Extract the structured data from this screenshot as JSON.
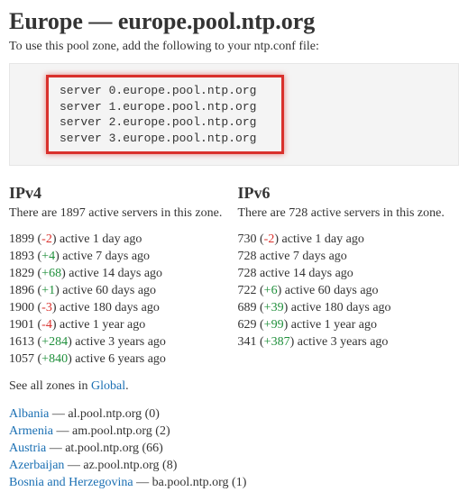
{
  "title": "Europe — europe.pool.ntp.org",
  "intro": "To use this pool zone, add the following to your ntp.conf file:",
  "config_lines": [
    "server 0.europe.pool.ntp.org",
    "server 1.europe.pool.ntp.org",
    "server 2.europe.pool.ntp.org",
    "server 3.europe.pool.ntp.org"
  ],
  "ipv4": {
    "heading": "IPv4",
    "summary_prefix": "There are ",
    "count": "1897",
    "summary_suffix": " active servers in this zone.",
    "history": [
      {
        "count": "1899",
        "delta": "-2",
        "delta_sign": "neg",
        "suffix": " active 1 day ago"
      },
      {
        "count": "1893",
        "delta": "+4",
        "delta_sign": "pos",
        "suffix": " active 7 days ago"
      },
      {
        "count": "1829",
        "delta": "+68",
        "delta_sign": "pos",
        "suffix": " active 14 days ago"
      },
      {
        "count": "1896",
        "delta": "+1",
        "delta_sign": "pos",
        "suffix": " active 60 days ago"
      },
      {
        "count": "1900",
        "delta": "-3",
        "delta_sign": "neg",
        "suffix": " active 180 days ago"
      },
      {
        "count": "1901",
        "delta": "-4",
        "delta_sign": "neg",
        "suffix": " active 1 year ago"
      },
      {
        "count": "1613",
        "delta": "+284",
        "delta_sign": "pos",
        "suffix": " active 3 years ago"
      },
      {
        "count": "1057",
        "delta": "+840",
        "delta_sign": "pos",
        "suffix": " active 6 years ago"
      }
    ]
  },
  "ipv6": {
    "heading": "IPv6",
    "summary_prefix": "There are ",
    "count": "728",
    "summary_suffix": " active servers in this zone.",
    "history": [
      {
        "count": "730",
        "delta": "-2",
        "delta_sign": "neg",
        "suffix": " active 1 day ago"
      },
      {
        "count": "728",
        "delta": "",
        "delta_sign": "",
        "suffix": " active 7 days ago"
      },
      {
        "count": "728",
        "delta": "",
        "delta_sign": "",
        "suffix": " active 14 days ago"
      },
      {
        "count": "722",
        "delta": "+6",
        "delta_sign": "pos",
        "suffix": " active 60 days ago"
      },
      {
        "count": "689",
        "delta": "+39",
        "delta_sign": "pos",
        "suffix": " active 180 days ago"
      },
      {
        "count": "629",
        "delta": "+99",
        "delta_sign": "pos",
        "suffix": " active 1 year ago"
      },
      {
        "count": "341",
        "delta": "+387",
        "delta_sign": "pos",
        "suffix": " active 3 years ago"
      }
    ]
  },
  "see_all": {
    "prefix": "See all zones in ",
    "link": "Global",
    "suffix": "."
  },
  "zones": [
    {
      "name": "Albania",
      "rest": " — al.pool.ntp.org (0)"
    },
    {
      "name": "Armenia",
      "rest": " — am.pool.ntp.org (2)"
    },
    {
      "name": "Austria",
      "rest": " — at.pool.ntp.org (66)"
    },
    {
      "name": "Azerbaijan",
      "rest": " — az.pool.ntp.org (8)"
    },
    {
      "name": "Bosnia and Herzegovina",
      "rest": " — ba.pool.ntp.org (1)"
    }
  ]
}
